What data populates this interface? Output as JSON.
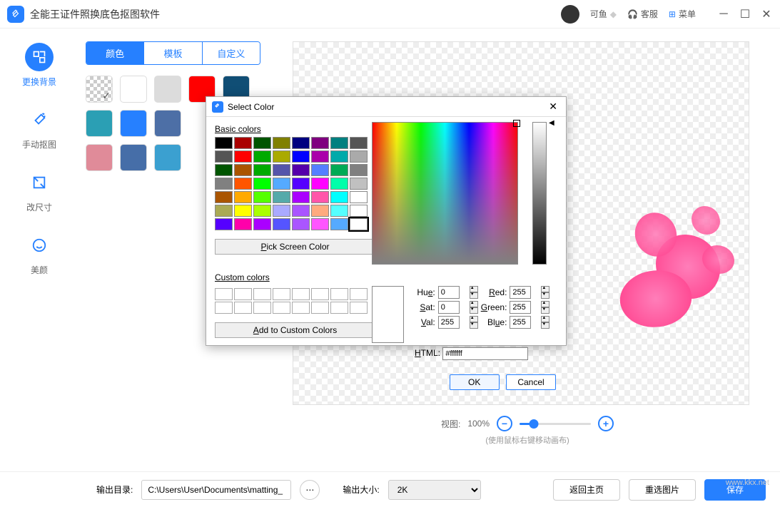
{
  "titlebar": {
    "app_title": "全能王证件照换底色抠图软件",
    "user_name": "可鱼",
    "support": "客服",
    "menu": "菜单"
  },
  "sidebar": {
    "items": [
      {
        "label": "更换背景"
      },
      {
        "label": "手动抠图"
      },
      {
        "label": "改尺寸"
      },
      {
        "label": "美颜"
      }
    ]
  },
  "tabs": {
    "color": "颜色",
    "template": "模板",
    "custom": "自定义"
  },
  "zoom": {
    "label": "视图:",
    "value": "100%",
    "hint": "(使用鼠标右键移动画布)"
  },
  "bottom": {
    "output_dir_label": "输出目录:",
    "output_dir": "C:\\Users\\User\\Documents\\matting_",
    "output_size_label": "输出大小:",
    "output_size": "2K",
    "back_home": "返回主页",
    "reselect": "重选图片",
    "save": "保存"
  },
  "dialog": {
    "title": "Select Color",
    "basic_label": "Basic colors",
    "pick_screen": "Pick Screen Color",
    "custom_label": "Custom colors",
    "add_custom": "Add to Custom Colors",
    "hue": "Hue:",
    "sat": "Sat:",
    "val": "Val:",
    "red": "Red:",
    "green": "Green:",
    "blue": "Blue:",
    "html_label": "HTML:",
    "hue_v": "0",
    "sat_v": "0",
    "val_v": "255",
    "red_v": "255",
    "green_v": "255",
    "blue_v": "255",
    "html_v": "#ffffff",
    "ok": "OK",
    "cancel": "Cancel"
  },
  "watermark": "www.kkx.net",
  "swatch_colors": [
    "transparent",
    "#ffffff",
    "#dcdcdc",
    "#ff0000",
    "#104e75",
    "#2b9fb4",
    "#2680ff",
    "#4d6fa6",
    "",
    "",
    "#e08b99",
    "#466ea8",
    "#3ba0d0"
  ],
  "basic_colors": [
    "#000000",
    "#aa0000",
    "#005500",
    "#808000",
    "#000080",
    "#800080",
    "#008080",
    "#555555",
    "#555555",
    "#ff0000",
    "#00aa00",
    "#aaaa00",
    "#0000ff",
    "#aa00aa",
    "#00aaaa",
    "#aaaaaa",
    "#005500",
    "#aa5500",
    "#00aa00",
    "#5555aa",
    "#5500aa",
    "#557fff",
    "#00aa55",
    "#808080",
    "#808080",
    "#ff5500",
    "#00ff00",
    "#55aaff",
    "#5500ff",
    "#ff00ff",
    "#00ffaa",
    "#c0c0c0",
    "#aa5500",
    "#ffaa00",
    "#55ff00",
    "#55aaaa",
    "#aa00ff",
    "#ff55aa",
    "#00ffff",
    "#ffffff",
    "#aaaa55",
    "#ffff00",
    "#aaff00",
    "#aaaaff",
    "#aa55ff",
    "#ffaa7f",
    "#55ffff",
    "#ffffff",
    "#5500ff",
    "#ff00aa",
    "#aa00ff",
    "#5555ff",
    "#aa55ff",
    "#ff55ff",
    "#55aaff",
    "#ffffff"
  ]
}
